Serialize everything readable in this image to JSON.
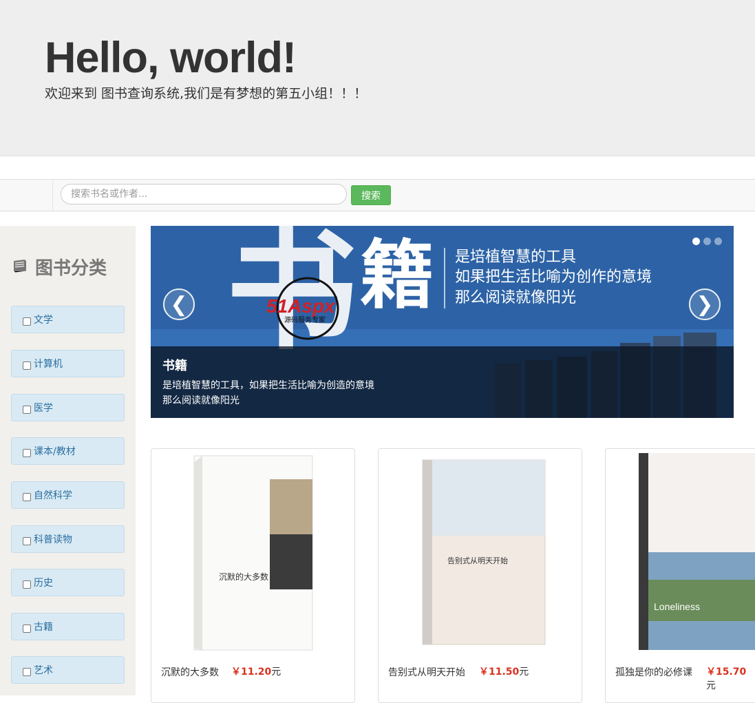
{
  "jumbotron": {
    "title": "Hello, world!",
    "subtitle": "欢迎来到 图书查询系统,我们是有梦想的第五小组！！！"
  },
  "search": {
    "placeholder": "搜索书名或作者...",
    "button_label": "搜索"
  },
  "sidebar": {
    "title": "图书分类",
    "icon": "book-icon",
    "categories": [
      {
        "label": "文学"
      },
      {
        "label": "计算机"
      },
      {
        "label": "医学"
      },
      {
        "label": "课本/教材"
      },
      {
        "label": "自然科学"
      },
      {
        "label": "科普读物"
      },
      {
        "label": "历史"
      },
      {
        "label": "古籍"
      },
      {
        "label": "艺术"
      }
    ]
  },
  "carousel": {
    "big_chars": [
      "书",
      "籍"
    ],
    "watermark": "51Aspx",
    "watermark_sub": "源码服务专家",
    "lines": [
      "是培植智慧的工具",
      "如果把生活比喻为创作的意境",
      "那么阅读就像阳光"
    ],
    "caption_title": "书籍",
    "caption_lines": [
      "是培植智慧的工具，如果把生活比喻为创造的意境",
      "那么阅读就像阳光"
    ],
    "prev_icon": "chevron-left-icon",
    "next_icon": "chevron-right-icon",
    "active_slide": 1,
    "slide_count": 3
  },
  "books": [
    {
      "name": "沉默的大多数",
      "currency": "￥",
      "price": "11.20",
      "unit": "元",
      "cover_title": "沉默的大多数",
      "cover_color": "#ffffff"
    },
    {
      "name": "告别式从明天开始",
      "currency": "￥",
      "price": "11.50",
      "unit": "元",
      "cover_title": "告别式从明天开始",
      "cover_color": "#f2e9e2"
    },
    {
      "name": "孤独是你的必修课",
      "currency": "￥",
      "price": "15.70",
      "unit": "元",
      "cover_title": "Loneliness",
      "cover_color": "#7ea3c2"
    }
  ],
  "colors": {
    "accent_green": "#5cb85c",
    "price_red": "#d9321f",
    "category_bg": "#d9eaf4"
  }
}
